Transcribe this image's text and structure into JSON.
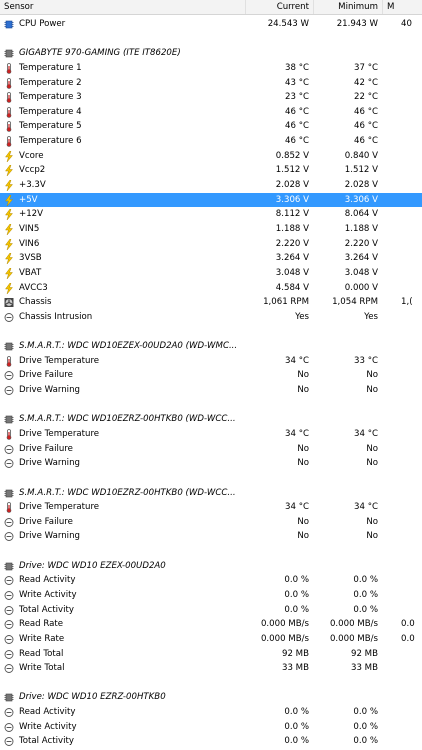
{
  "header": {
    "sensor": "Sensor",
    "current": "Current",
    "minimum": "Minimum",
    "maximum": "M"
  },
  "rows": [
    {
      "type": "sensor",
      "icon": "cpu-chip-icon",
      "label": "CPU Power",
      "current": "24.543 W",
      "minimum": "21.943 W",
      "maximum": "40"
    },
    {
      "type": "blank"
    },
    {
      "type": "group",
      "icon": "chip-icon",
      "label": "GIGABYTE 970-GAMING (ITE IT8620E)"
    },
    {
      "type": "sensor",
      "icon": "thermometer-icon",
      "label": "Temperature 1",
      "current": "38 °C",
      "minimum": "37 °C"
    },
    {
      "type": "sensor",
      "icon": "thermometer-icon",
      "label": "Temperature 2",
      "current": "43 °C",
      "minimum": "42 °C"
    },
    {
      "type": "sensor",
      "icon": "thermometer-icon",
      "label": "Temperature 3",
      "current": "23 °C",
      "minimum": "22 °C"
    },
    {
      "type": "sensor",
      "icon": "thermometer-icon",
      "label": "Temperature 4",
      "current": "46 °C",
      "minimum": "46 °C"
    },
    {
      "type": "sensor",
      "icon": "thermometer-icon",
      "label": "Temperature 5",
      "current": "46 °C",
      "minimum": "46 °C"
    },
    {
      "type": "sensor",
      "icon": "thermometer-icon",
      "label": "Temperature 6",
      "current": "46 °C",
      "minimum": "46 °C"
    },
    {
      "type": "sensor",
      "icon": "lightning-icon",
      "label": "Vcore",
      "current": "0.852 V",
      "minimum": "0.840 V"
    },
    {
      "type": "sensor",
      "icon": "lightning-icon",
      "label": "Vccp2",
      "current": "1.512 V",
      "minimum": "1.512 V"
    },
    {
      "type": "sensor",
      "icon": "lightning-icon",
      "label": "+3.3V",
      "current": "2.028 V",
      "minimum": "2.028 V"
    },
    {
      "type": "sensor",
      "icon": "lightning-icon",
      "label": "+5V",
      "current": "3.306 V",
      "minimum": "3.306 V",
      "selected": true
    },
    {
      "type": "sensor",
      "icon": "lightning-icon",
      "label": "+12V",
      "current": "8.112 V",
      "minimum": "8.064 V"
    },
    {
      "type": "sensor",
      "icon": "lightning-icon",
      "label": "VIN5",
      "current": "1.188 V",
      "minimum": "1.188 V"
    },
    {
      "type": "sensor",
      "icon": "lightning-icon",
      "label": "VIN6",
      "current": "2.220 V",
      "minimum": "2.220 V"
    },
    {
      "type": "sensor",
      "icon": "lightning-icon",
      "label": "3VSB",
      "current": "3.264 V",
      "minimum": "3.264 V"
    },
    {
      "type": "sensor",
      "icon": "lightning-icon",
      "label": "VBAT",
      "current": "3.048 V",
      "minimum": "3.048 V"
    },
    {
      "type": "sensor",
      "icon": "lightning-icon",
      "label": "AVCC3",
      "current": "4.584 V",
      "minimum": "0.000 V"
    },
    {
      "type": "sensor",
      "icon": "fan-icon",
      "label": "Chassis",
      "current": "1,061 RPM",
      "minimum": "1,054 RPM",
      "maximum": "1,("
    },
    {
      "type": "sensor",
      "icon": "circle-minus-icon",
      "label": "Chassis Intrusion",
      "current": "Yes",
      "minimum": "Yes"
    },
    {
      "type": "blank"
    },
    {
      "type": "group",
      "icon": "chip-icon",
      "label": "S.M.A.R.T.: WDC WD10EZEX-00UD2A0 (WD-WMC..."
    },
    {
      "type": "sensor",
      "icon": "thermometer-icon",
      "label": "Drive Temperature",
      "current": "34 °C",
      "minimum": "33 °C"
    },
    {
      "type": "sensor",
      "icon": "circle-minus-icon",
      "label": "Drive Failure",
      "current": "No",
      "minimum": "No"
    },
    {
      "type": "sensor",
      "icon": "circle-minus-icon",
      "label": "Drive Warning",
      "current": "No",
      "minimum": "No"
    },
    {
      "type": "blank"
    },
    {
      "type": "group",
      "icon": "chip-icon",
      "label": "S.M.A.R.T.: WDC WD10EZRZ-00HTKB0 (WD-WCC..."
    },
    {
      "type": "sensor",
      "icon": "thermometer-icon",
      "label": "Drive Temperature",
      "current": "34 °C",
      "minimum": "34 °C"
    },
    {
      "type": "sensor",
      "icon": "circle-minus-icon",
      "label": "Drive Failure",
      "current": "No",
      "minimum": "No"
    },
    {
      "type": "sensor",
      "icon": "circle-minus-icon",
      "label": "Drive Warning",
      "current": "No",
      "minimum": "No"
    },
    {
      "type": "blank"
    },
    {
      "type": "group",
      "icon": "chip-icon",
      "label": "S.M.A.R.T.: WDC WD10EZRZ-00HTKB0 (WD-WCC..."
    },
    {
      "type": "sensor",
      "icon": "thermometer-icon",
      "label": "Drive Temperature",
      "current": "34 °C",
      "minimum": "34 °C"
    },
    {
      "type": "sensor",
      "icon": "circle-minus-icon",
      "label": "Drive Failure",
      "current": "No",
      "minimum": "No"
    },
    {
      "type": "sensor",
      "icon": "circle-minus-icon",
      "label": "Drive Warning",
      "current": "No",
      "minimum": "No"
    },
    {
      "type": "blank"
    },
    {
      "type": "group",
      "icon": "chip-icon",
      "label": "Drive: WDC WD10 EZEX-00UD2A0"
    },
    {
      "type": "sensor",
      "icon": "circle-minus-icon",
      "label": "Read Activity",
      "current": "0.0 %",
      "minimum": "0.0 %"
    },
    {
      "type": "sensor",
      "icon": "circle-minus-icon",
      "label": "Write Activity",
      "current": "0.0 %",
      "minimum": "0.0 %"
    },
    {
      "type": "sensor",
      "icon": "circle-minus-icon",
      "label": "Total Activity",
      "current": "0.0 %",
      "minimum": "0.0 %"
    },
    {
      "type": "sensor",
      "icon": "circle-minus-icon",
      "label": "Read Rate",
      "current": "0.000 MB/s",
      "minimum": "0.000 MB/s",
      "maximum": "0.0"
    },
    {
      "type": "sensor",
      "icon": "circle-minus-icon",
      "label": "Write Rate",
      "current": "0.000 MB/s",
      "minimum": "0.000 MB/s",
      "maximum": "0.0"
    },
    {
      "type": "sensor",
      "icon": "circle-minus-icon",
      "label": "Read Total",
      "current": "92 MB",
      "minimum": "92 MB"
    },
    {
      "type": "sensor",
      "icon": "circle-minus-icon",
      "label": "Write Total",
      "current": "33 MB",
      "minimum": "33 MB"
    },
    {
      "type": "blank"
    },
    {
      "type": "group",
      "icon": "chip-icon",
      "label": "Drive: WDC WD10 EZRZ-00HTKB0"
    },
    {
      "type": "sensor",
      "icon": "circle-minus-icon",
      "label": "Read Activity",
      "current": "0.0 %",
      "minimum": "0.0 %"
    },
    {
      "type": "sensor",
      "icon": "circle-minus-icon",
      "label": "Write Activity",
      "current": "0.0 %",
      "minimum": "0.0 %"
    },
    {
      "type": "sensor",
      "icon": "circle-minus-icon",
      "label": "Total Activity",
      "current": "0.0 %",
      "minimum": "0.0 %"
    }
  ]
}
